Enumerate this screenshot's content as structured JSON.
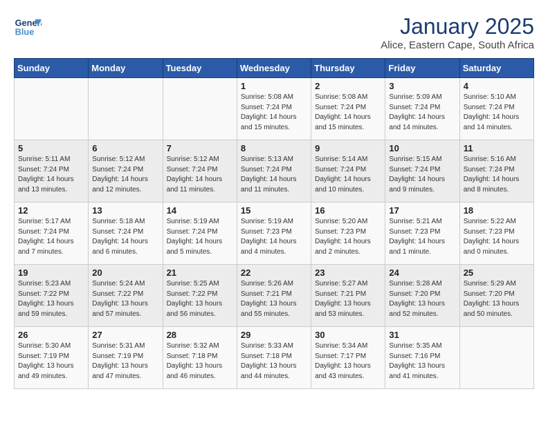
{
  "header": {
    "logo_line1": "General",
    "logo_line2": "Blue",
    "month": "January 2025",
    "location": "Alice, Eastern Cape, South Africa"
  },
  "weekdays": [
    "Sunday",
    "Monday",
    "Tuesday",
    "Wednesday",
    "Thursday",
    "Friday",
    "Saturday"
  ],
  "weeks": [
    [
      {
        "day": "",
        "info": ""
      },
      {
        "day": "",
        "info": ""
      },
      {
        "day": "",
        "info": ""
      },
      {
        "day": "1",
        "info": "Sunrise: 5:08 AM\nSunset: 7:24 PM\nDaylight: 14 hours\nand 15 minutes."
      },
      {
        "day": "2",
        "info": "Sunrise: 5:08 AM\nSunset: 7:24 PM\nDaylight: 14 hours\nand 15 minutes."
      },
      {
        "day": "3",
        "info": "Sunrise: 5:09 AM\nSunset: 7:24 PM\nDaylight: 14 hours\nand 14 minutes."
      },
      {
        "day": "4",
        "info": "Sunrise: 5:10 AM\nSunset: 7:24 PM\nDaylight: 14 hours\nand 14 minutes."
      }
    ],
    [
      {
        "day": "5",
        "info": "Sunrise: 5:11 AM\nSunset: 7:24 PM\nDaylight: 14 hours\nand 13 minutes."
      },
      {
        "day": "6",
        "info": "Sunrise: 5:12 AM\nSunset: 7:24 PM\nDaylight: 14 hours\nand 12 minutes."
      },
      {
        "day": "7",
        "info": "Sunrise: 5:12 AM\nSunset: 7:24 PM\nDaylight: 14 hours\nand 11 minutes."
      },
      {
        "day": "8",
        "info": "Sunrise: 5:13 AM\nSunset: 7:24 PM\nDaylight: 14 hours\nand 11 minutes."
      },
      {
        "day": "9",
        "info": "Sunrise: 5:14 AM\nSunset: 7:24 PM\nDaylight: 14 hours\nand 10 minutes."
      },
      {
        "day": "10",
        "info": "Sunrise: 5:15 AM\nSunset: 7:24 PM\nDaylight: 14 hours\nand 9 minutes."
      },
      {
        "day": "11",
        "info": "Sunrise: 5:16 AM\nSunset: 7:24 PM\nDaylight: 14 hours\nand 8 minutes."
      }
    ],
    [
      {
        "day": "12",
        "info": "Sunrise: 5:17 AM\nSunset: 7:24 PM\nDaylight: 14 hours\nand 7 minutes."
      },
      {
        "day": "13",
        "info": "Sunrise: 5:18 AM\nSunset: 7:24 PM\nDaylight: 14 hours\nand 6 minutes."
      },
      {
        "day": "14",
        "info": "Sunrise: 5:19 AM\nSunset: 7:24 PM\nDaylight: 14 hours\nand 5 minutes."
      },
      {
        "day": "15",
        "info": "Sunrise: 5:19 AM\nSunset: 7:23 PM\nDaylight: 14 hours\nand 4 minutes."
      },
      {
        "day": "16",
        "info": "Sunrise: 5:20 AM\nSunset: 7:23 PM\nDaylight: 14 hours\nand 2 minutes."
      },
      {
        "day": "17",
        "info": "Sunrise: 5:21 AM\nSunset: 7:23 PM\nDaylight: 14 hours\nand 1 minute."
      },
      {
        "day": "18",
        "info": "Sunrise: 5:22 AM\nSunset: 7:23 PM\nDaylight: 14 hours\nand 0 minutes."
      }
    ],
    [
      {
        "day": "19",
        "info": "Sunrise: 5:23 AM\nSunset: 7:22 PM\nDaylight: 13 hours\nand 59 minutes."
      },
      {
        "day": "20",
        "info": "Sunrise: 5:24 AM\nSunset: 7:22 PM\nDaylight: 13 hours\nand 57 minutes."
      },
      {
        "day": "21",
        "info": "Sunrise: 5:25 AM\nSunset: 7:22 PM\nDaylight: 13 hours\nand 56 minutes."
      },
      {
        "day": "22",
        "info": "Sunrise: 5:26 AM\nSunset: 7:21 PM\nDaylight: 13 hours\nand 55 minutes."
      },
      {
        "day": "23",
        "info": "Sunrise: 5:27 AM\nSunset: 7:21 PM\nDaylight: 13 hours\nand 53 minutes."
      },
      {
        "day": "24",
        "info": "Sunrise: 5:28 AM\nSunset: 7:20 PM\nDaylight: 13 hours\nand 52 minutes."
      },
      {
        "day": "25",
        "info": "Sunrise: 5:29 AM\nSunset: 7:20 PM\nDaylight: 13 hours\nand 50 minutes."
      }
    ],
    [
      {
        "day": "26",
        "info": "Sunrise: 5:30 AM\nSunset: 7:19 PM\nDaylight: 13 hours\nand 49 minutes."
      },
      {
        "day": "27",
        "info": "Sunrise: 5:31 AM\nSunset: 7:19 PM\nDaylight: 13 hours\nand 47 minutes."
      },
      {
        "day": "28",
        "info": "Sunrise: 5:32 AM\nSunset: 7:18 PM\nDaylight: 13 hours\nand 46 minutes."
      },
      {
        "day": "29",
        "info": "Sunrise: 5:33 AM\nSunset: 7:18 PM\nDaylight: 13 hours\nand 44 minutes."
      },
      {
        "day": "30",
        "info": "Sunrise: 5:34 AM\nSunset: 7:17 PM\nDaylight: 13 hours\nand 43 minutes."
      },
      {
        "day": "31",
        "info": "Sunrise: 5:35 AM\nSunset: 7:16 PM\nDaylight: 13 hours\nand 41 minutes."
      },
      {
        "day": "",
        "info": ""
      }
    ]
  ]
}
